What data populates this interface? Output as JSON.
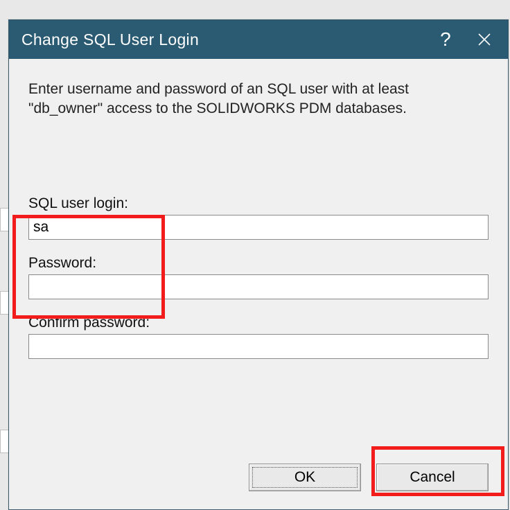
{
  "dialog": {
    "title": "Change SQL User Login",
    "instruction": "Enter username and password of an SQL user with at least \"db_owner\" access to the SOLIDWORKS PDM databases."
  },
  "fields": {
    "login_label": "SQL user login:",
    "login_value": "sa",
    "password_label": "Password:",
    "password_value": "",
    "confirm_label": "Confirm password:",
    "confirm_value": ""
  },
  "buttons": {
    "ok": "OK",
    "cancel": "Cancel"
  },
  "titlebar": {
    "help": "?",
    "close": "×"
  }
}
